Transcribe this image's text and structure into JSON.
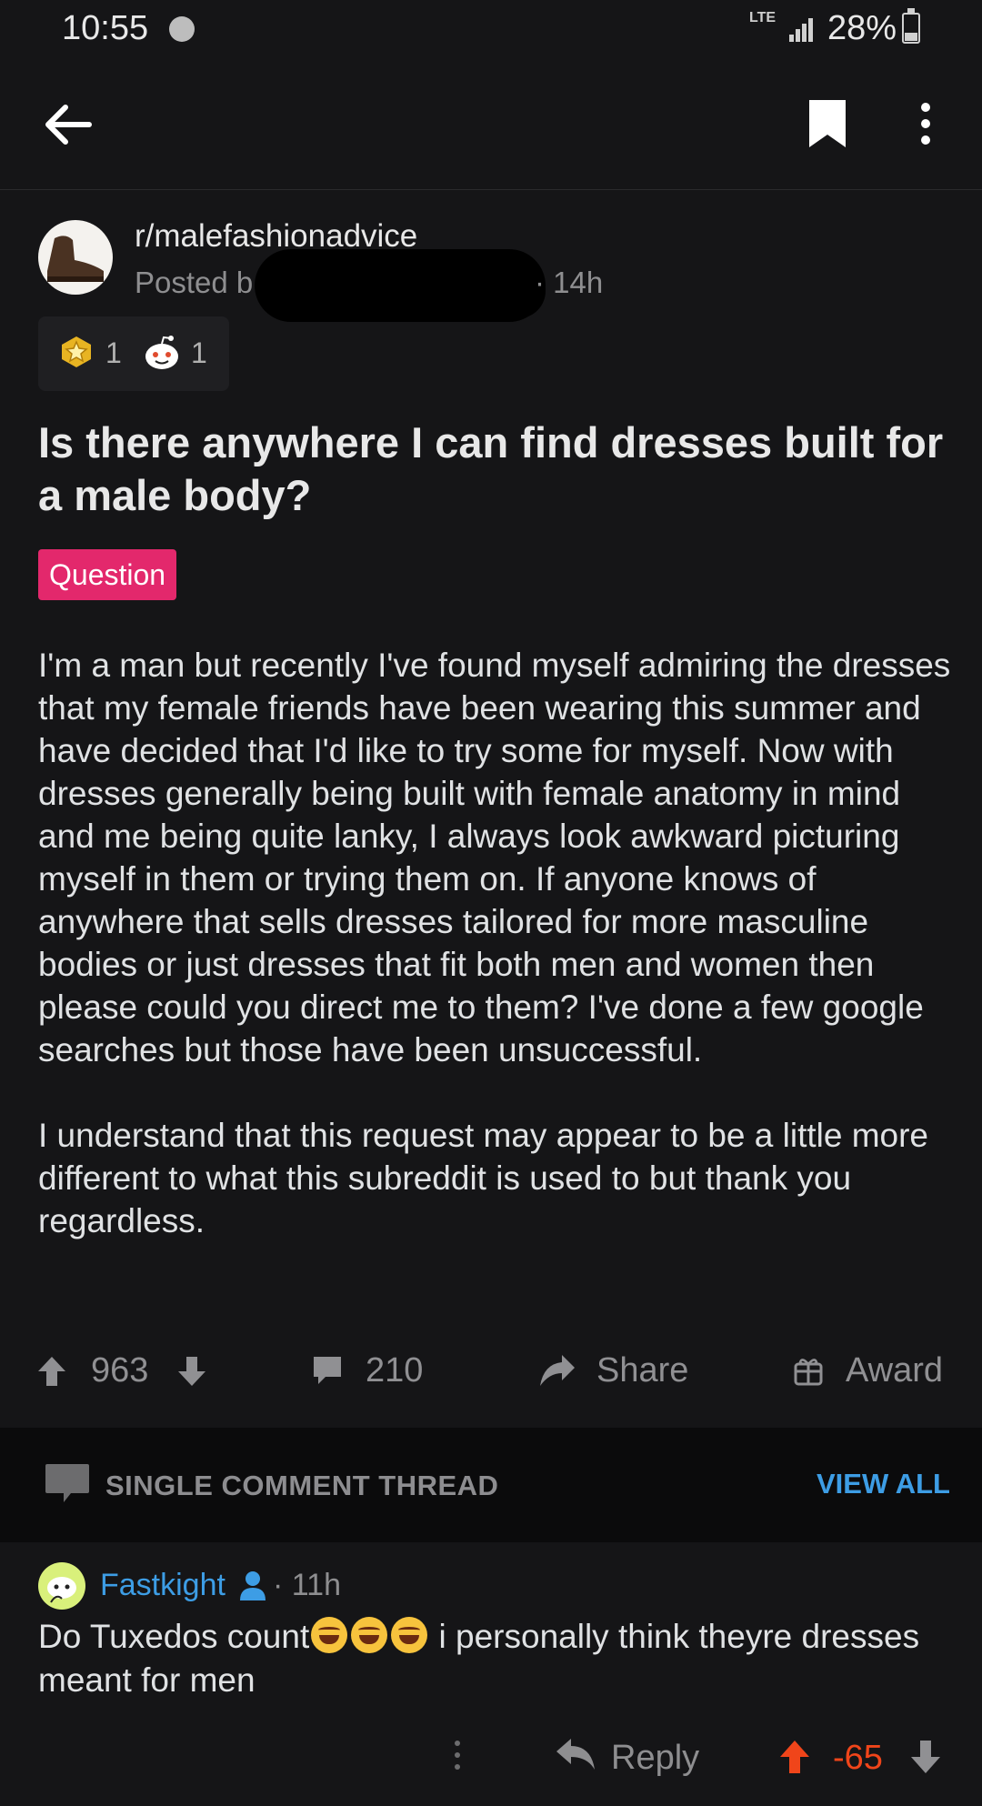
{
  "status_bar": {
    "time": "10:55",
    "network": "LTE",
    "battery": "28%"
  },
  "post": {
    "subreddit": "r/malefashionadvice",
    "posted_by_prefix": "Posted b",
    "age": "· 14h",
    "awards": [
      {
        "icon": "gold-star-award-icon",
        "count": "1"
      },
      {
        "icon": "wholesome-face-award-icon",
        "count": "1"
      }
    ],
    "title": "Is there anywhere I can find dresses built for a male body?",
    "flair": "Question",
    "flair_color": "#e3286c",
    "body": [
      "I'm a man but recently I've found myself admiring the dresses that my female friends have been wearing this summer and have decided that I'd like to try some for myself. Now with dresses generally being built with female anatomy in mind and me being quite lanky, I always look awkward picturing myself in them or trying them on. If anyone knows of anywhere that sells dresses tailored for more masculine bodies or just dresses that fit both men and women then please could you direct me to them? I've done a few google searches but those have been unsuccessful.",
      "I understand that this request may appear to be a little more different to what this subreddit is used to but thank you regardless."
    ],
    "votes": "963",
    "comments": "210",
    "share_label": "Share",
    "award_label": "Award"
  },
  "thread_bar": {
    "label": "SINGLE COMMENT THREAD",
    "view_all": "VIEW ALL"
  },
  "comment": {
    "username": "Fastkight",
    "age": "· 11h",
    "text_before": "Do Tuxedos count",
    "text_after": " i personally think theyre dresses meant for men",
    "emojis": [
      "tears-of-joy-emoji",
      "tears-of-joy-emoji",
      "tears-of-joy-emoji"
    ],
    "reply_label": "Reply",
    "score": "-65",
    "score_color": "#f0451a"
  },
  "colors": {
    "background": "#151517",
    "link_blue": "#3d9de5"
  }
}
